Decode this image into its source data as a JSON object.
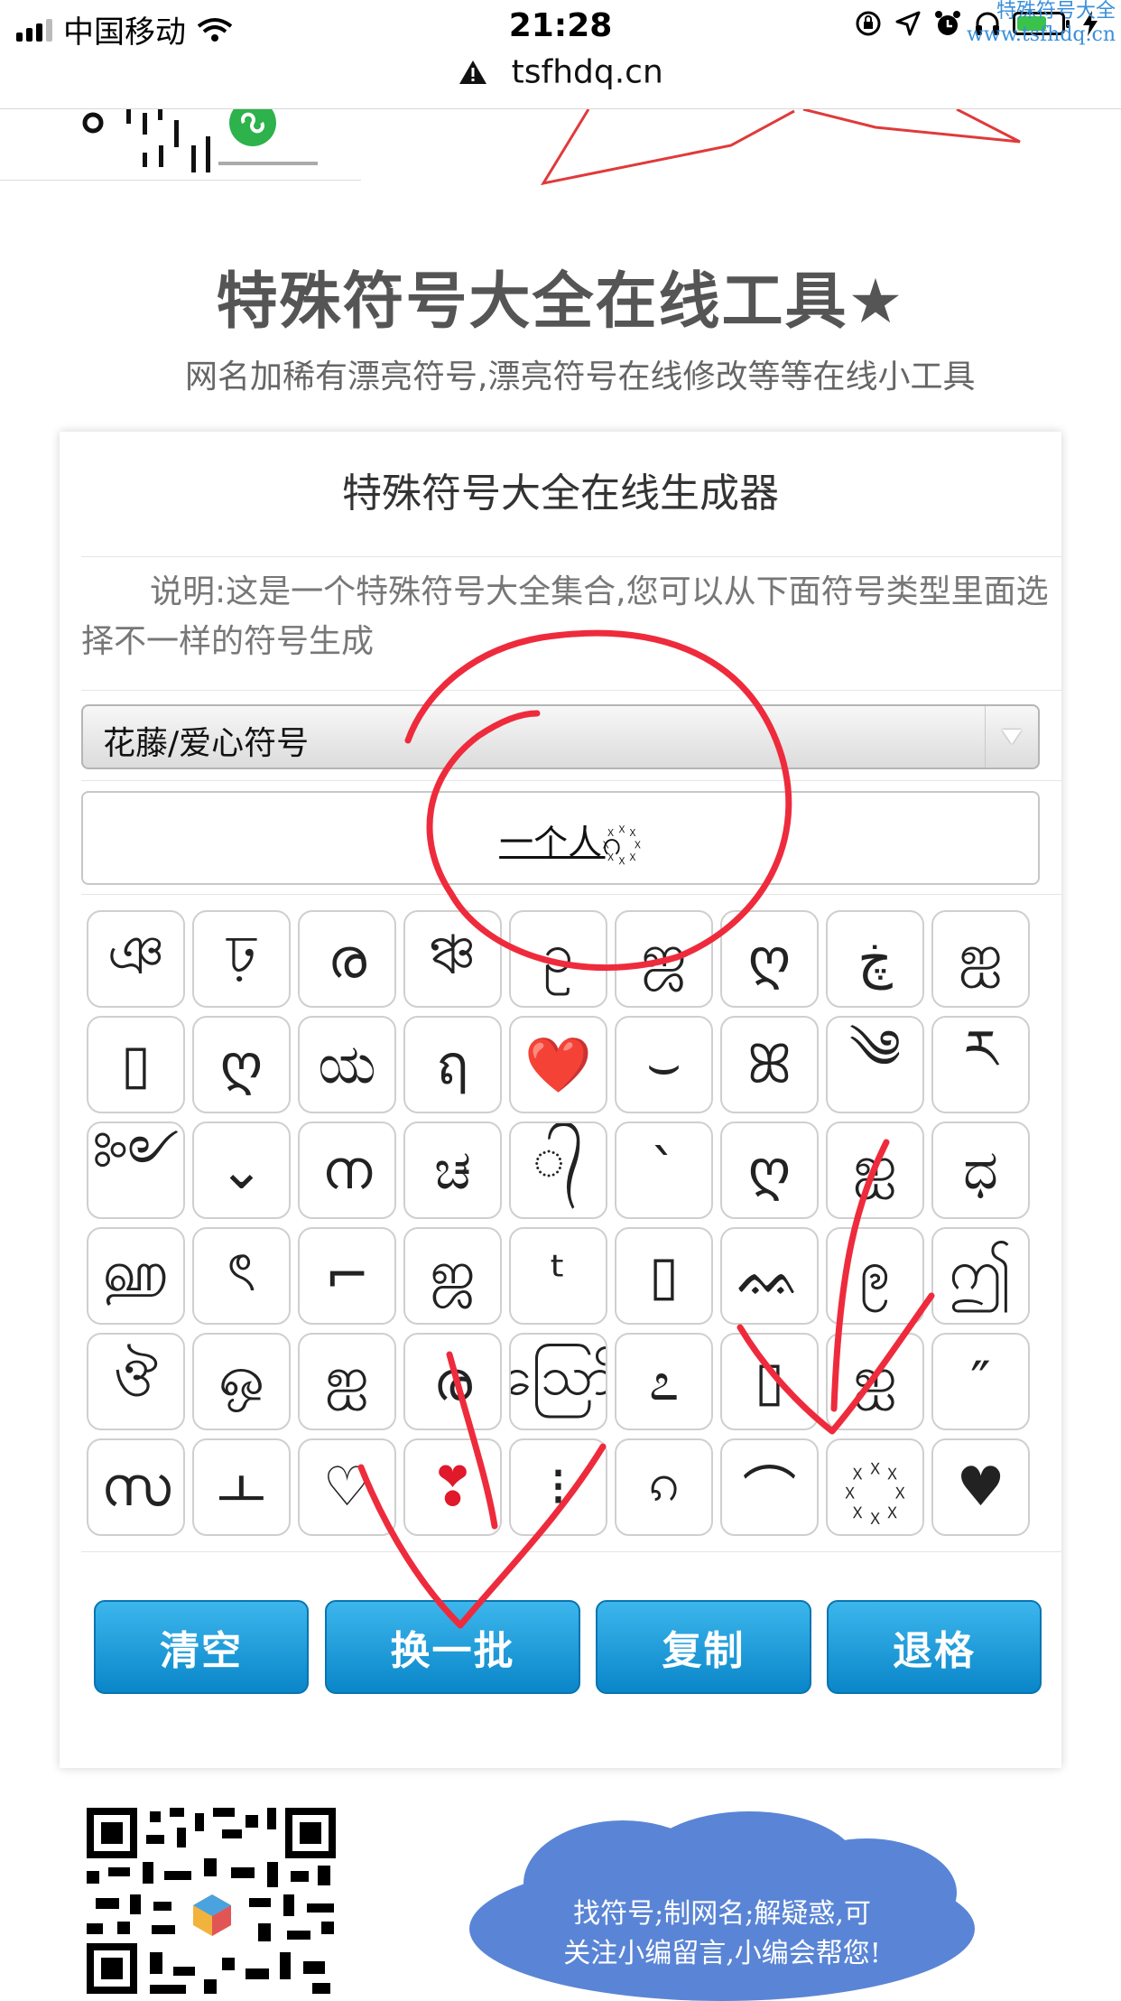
{
  "status_bar": {
    "carrier": "中国移动",
    "time": "21:28",
    "watermark_line1": "特殊符号大全",
    "watermark_line2": "www.tsfhdq.cn"
  },
  "url_bar": {
    "domain": "tsfhdq.cn"
  },
  "header": {
    "title": "特殊符号大全在线工具★",
    "subtitle": "网名加稀有漂亮符号,漂亮符号在线修改等等在线小工具"
  },
  "tool": {
    "title": "特殊符号大全在线生成器",
    "description": "说明:这是一个特殊符号大全集合,您可以从下面符号类型里面选择不一样的符号生成",
    "category_select": {
      "selected": "花藤/爱心符号"
    },
    "output_value": "一个人ဂ꙰",
    "symbols": [
      [
        "ঞ",
        "ঢ়",
        "ര",
        "ঞ্চ",
        "ဥ",
        "ஜ",
        "ღ",
        "ڿ",
        "ஐ"
      ],
      [
        "▯",
        "ღ",
        "ಯ",
        "ฤ",
        "❤️",
        "⌣",
        "ꕤ",
        "༄",
        "ཪ"
      ],
      [
        "༻",
        "⌄",
        "ന",
        "ಚ",
        "᭄",
        "ˋ",
        "ღ",
        "ஐ",
        "ಧ"
      ],
      [
        "ஹ",
        "ৎ",
        "⌐",
        "ஜ",
        "ᵗ",
        "▯",
        "ᨐ",
        "ဨ",
        "ဤ"
      ],
      [
        "ঔ",
        "ஒ",
        "ஐ",
        "ര",
        "ဪ",
        "೭",
        "▯",
        "ஐ",
        "″"
      ],
      [
        "സ",
        "ㅗ",
        "♡",
        "❣",
        "⁝",
        "ၵ",
        "⌒",
        "꙰",
        "♥"
      ]
    ],
    "buttons": {
      "clear": "清空",
      "refresh": "换一批",
      "copy": "复制",
      "backspace": "退格"
    }
  },
  "footer": {
    "cloud_line1": "找符号;制网名;解疑惑,可",
    "cloud_line2": "关注小编留言,小编会帮您!"
  }
}
